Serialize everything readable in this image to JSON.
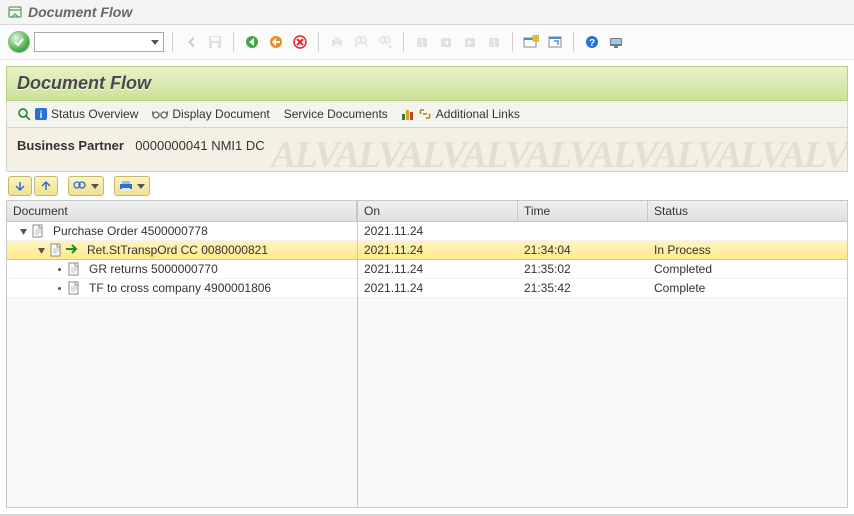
{
  "window": {
    "title": "Document Flow"
  },
  "section": {
    "title": "Document Flow"
  },
  "app_toolbar": {
    "status_overview": "Status Overview",
    "display_document": "Display Document",
    "service_documents": "Service Documents",
    "additional_links": "Additional Links"
  },
  "bp": {
    "label": "Business Partner",
    "value": "0000000041 NMI1 DC"
  },
  "columns": {
    "document": "Document",
    "on": "On",
    "time": "Time",
    "status": "Status"
  },
  "rows": [
    {
      "level": 0,
      "expander": "open",
      "label": "Purchase Order 4500000778",
      "on": "2021.11.24",
      "time": "",
      "status": "",
      "selected": false,
      "hasArrow": false
    },
    {
      "level": 1,
      "expander": "open",
      "label": "Ret.StTranspOrd CC 0080000821",
      "on": "2021.11.24",
      "time": "21:34:04",
      "status": "In Process",
      "selected": true,
      "hasArrow": true
    },
    {
      "level": 2,
      "expander": "leaf",
      "label": "GR returns 5000000770",
      "on": "2021.11.24",
      "time": "21:35:02",
      "status": "Completed",
      "selected": false,
      "hasArrow": false
    },
    {
      "level": 2,
      "expander": "leaf",
      "label": "TF to cross company 4900001806",
      "on": "2021.11.24",
      "time": "21:35:42",
      "status": "Complete",
      "selected": false,
      "hasArrow": false
    }
  ]
}
